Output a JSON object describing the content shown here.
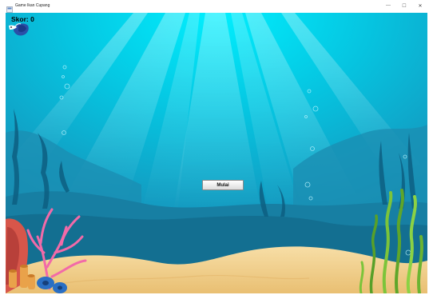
{
  "window": {
    "title": "Game Ikan Cupang",
    "minimize_glyph": "—",
    "maximize_glyph": "☐",
    "close_glyph": "✕"
  },
  "hud": {
    "score_text": "Skor: 0"
  },
  "menu": {
    "start_label": "Mulai"
  },
  "icons": {
    "app": "java-app-icon",
    "player": "betta-fish-icon"
  },
  "colors": {
    "water_top": "#00e5f5",
    "water_mid": "#10a9cc",
    "water_deep": "#0e7fa3",
    "sand": "#f2d293",
    "coral_pink": "#f06aa6",
    "seaweed_green": "#7cc43a"
  }
}
